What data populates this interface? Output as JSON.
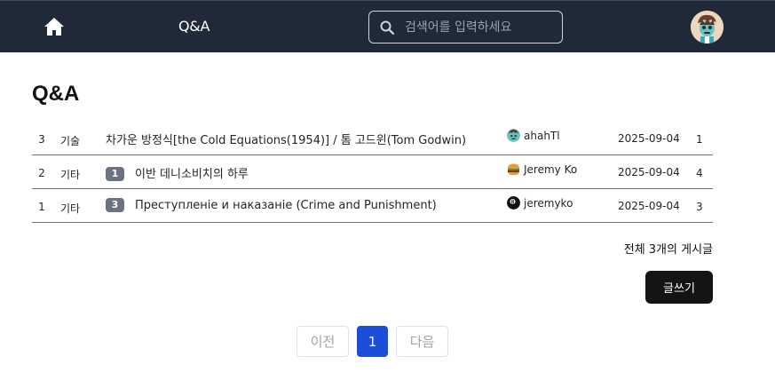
{
  "nav": {
    "home_icon": "home-icon",
    "qa_link": "Q&A",
    "search_placeholder": "검색어를 입력하세요",
    "search_icon": "search-icon",
    "avatar_icon": "avatar"
  },
  "page": {
    "title": "Q&A"
  },
  "posts": [
    {
      "num": "3",
      "category": "기술",
      "comments": "",
      "title": "차가운 방정식[the Cold Equations(1954)] / 톰 고드윈(Tom Godwin)",
      "author": "ahahTl",
      "author_icon": "zombie-icon",
      "date": "2025-09-04",
      "views": "1"
    },
    {
      "num": "2",
      "category": "기타",
      "comments": "1",
      "title": "이반 데니소비치의 하루",
      "author": "Jeremy Ko",
      "author_icon": "burger-icon",
      "date": "2025-09-04",
      "views": "4"
    },
    {
      "num": "1",
      "category": "기타",
      "comments": "3",
      "title": "Преступленіе и наказаніе (Crime and Punishment)",
      "author": "jeremyko",
      "author_icon": "8ball-icon",
      "date": "2025-09-04",
      "views": "3"
    }
  ],
  "summary": {
    "total": "전체 3개의 게시글"
  },
  "actions": {
    "write": "글쓰기"
  },
  "pagination": {
    "prev": "이전",
    "current": "1",
    "next": "다음"
  },
  "colors": {
    "navbar": "#1f2937",
    "active_page": "#1d4ed8",
    "write_button": "#141414",
    "badge": "#6b7280"
  }
}
